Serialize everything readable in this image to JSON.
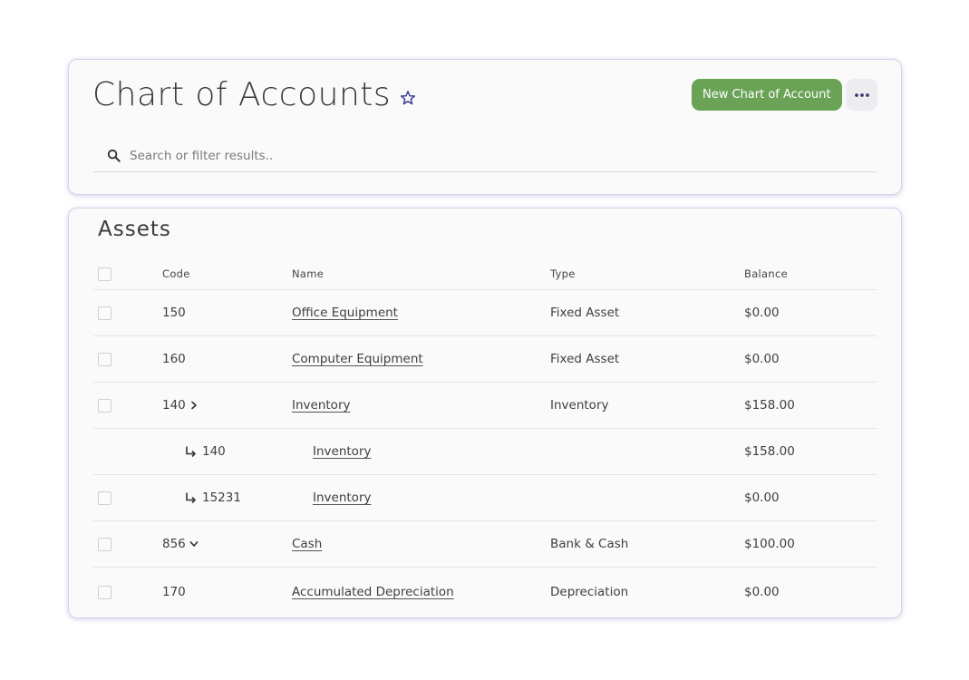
{
  "header": {
    "title": "Chart of Accounts",
    "new_button_label": "New Chart of Account",
    "search_placeholder": "Search or filter results.."
  },
  "icons": {
    "favorite": "star-icon",
    "more": "ellipsis-icon",
    "search": "search-icon",
    "expand": "chevron-right-icon",
    "collapse": "chevron-down-icon",
    "subaccount": "subaccount-arrow-icon"
  },
  "colors": {
    "primary": "#6aa356",
    "star": "#3b3f8f",
    "card_border": "#d4d2ea"
  },
  "assets": {
    "section_title": "Assets",
    "columns": {
      "code": "Code",
      "name": "Name",
      "type": "Type",
      "balance": "Balance"
    },
    "rows": [
      {
        "code": "150",
        "name": "Office Equipment",
        "type": "Fixed Asset",
        "balance": "$0.00"
      },
      {
        "code": "160",
        "name": "Computer Equipment",
        "type": "Fixed Asset",
        "balance": "$0.00"
      },
      {
        "code": "140",
        "name": "Inventory",
        "type": "Inventory",
        "balance": "$158.00"
      },
      {
        "code": "140",
        "name": "Inventory",
        "type": "",
        "balance": "$158.00"
      },
      {
        "code": "15231",
        "name": "Inventory",
        "type": "",
        "balance": "$0.00"
      },
      {
        "code": "856",
        "name": "Cash",
        "type": "Bank & Cash",
        "balance": "$100.00"
      },
      {
        "code": "170",
        "name": "Accumulated Depreciation",
        "type": "Depreciation",
        "balance": "$0.00"
      }
    ]
  }
}
